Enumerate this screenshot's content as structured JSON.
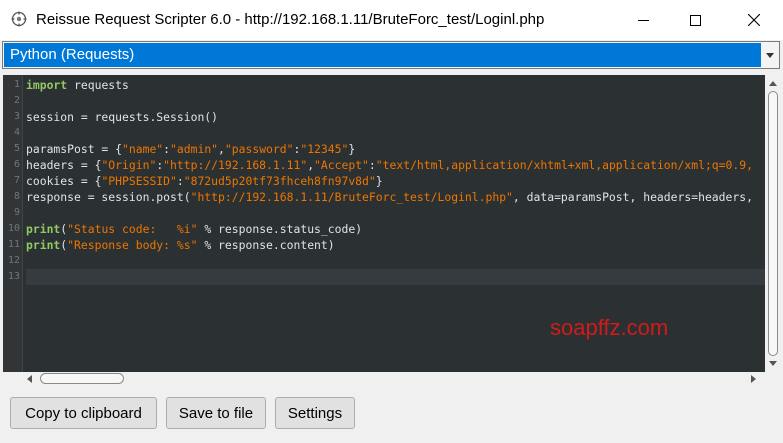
{
  "window": {
    "title": "Reissue Request Scripter 6.0 - http://192.168.1.11/BruteForc_test/Loginl.php",
    "controls": [
      "minimize-icon",
      "maximize-icon",
      "close-icon"
    ]
  },
  "language_select": {
    "value": "Python (Requests)"
  },
  "editor": {
    "line_numbers": [
      "1",
      "2",
      "3",
      "4",
      "5",
      "6",
      "7",
      "8",
      "9",
      "10",
      "11",
      "12",
      "13"
    ],
    "active_line": 13,
    "lines": [
      [
        {
          "t": "kw",
          "v": "import"
        },
        {
          "t": "p",
          "v": " requests"
        }
      ],
      [],
      [
        {
          "t": "p",
          "v": "session = requests.Session()"
        }
      ],
      [],
      [
        {
          "t": "p",
          "v": "paramsPost = {"
        },
        {
          "t": "st",
          "v": "\"name\""
        },
        {
          "t": "p",
          "v": ":"
        },
        {
          "t": "st",
          "v": "\"admin\""
        },
        {
          "t": "p",
          "v": ","
        },
        {
          "t": "st",
          "v": "\"password\""
        },
        {
          "t": "p",
          "v": ":"
        },
        {
          "t": "st",
          "v": "\"12345\""
        },
        {
          "t": "p",
          "v": "}"
        }
      ],
      [
        {
          "t": "p",
          "v": "headers = {"
        },
        {
          "t": "st",
          "v": "\"Origin\""
        },
        {
          "t": "p",
          "v": ":"
        },
        {
          "t": "st",
          "v": "\"http://192.168.1.11\""
        },
        {
          "t": "p",
          "v": ","
        },
        {
          "t": "st",
          "v": "\"Accept\""
        },
        {
          "t": "p",
          "v": ":"
        },
        {
          "t": "st",
          "v": "\"text/html,application/xhtml+xml,application/xml;q=0.9,"
        }
      ],
      [
        {
          "t": "p",
          "v": "cookies = {"
        },
        {
          "t": "st",
          "v": "\"PHPSESSID\""
        },
        {
          "t": "p",
          "v": ":"
        },
        {
          "t": "st",
          "v": "\"872ud5p20tf73fhceh8fn97v8d\""
        },
        {
          "t": "p",
          "v": "}"
        }
      ],
      [
        {
          "t": "p",
          "v": "response = session.post("
        },
        {
          "t": "st",
          "v": "\"http://192.168.1.11/BruteForc_test/Loginl.php\""
        },
        {
          "t": "p",
          "v": ", data=paramsPost, headers=headers,"
        }
      ],
      [],
      [
        {
          "t": "kw",
          "v": "print"
        },
        {
          "t": "p",
          "v": "("
        },
        {
          "t": "st",
          "v": "\"Status code:   %i\""
        },
        {
          "t": "p",
          "v": " % response.status_code)"
        }
      ],
      [
        {
          "t": "kw",
          "v": "print"
        },
        {
          "t": "p",
          "v": "("
        },
        {
          "t": "st",
          "v": "\"Response body: %s\""
        },
        {
          "t": "p",
          "v": " % response.content)"
        }
      ],
      [],
      []
    ],
    "watermark": "soapffz.com",
    "colors": {
      "background": "#2b3033",
      "keyword": "#93c763",
      "string": "#ec7600",
      "plain": "#dfe4e6"
    }
  },
  "buttons": {
    "copy": "Copy to clipboard",
    "save": "Save to file",
    "settings": "Settings"
  }
}
